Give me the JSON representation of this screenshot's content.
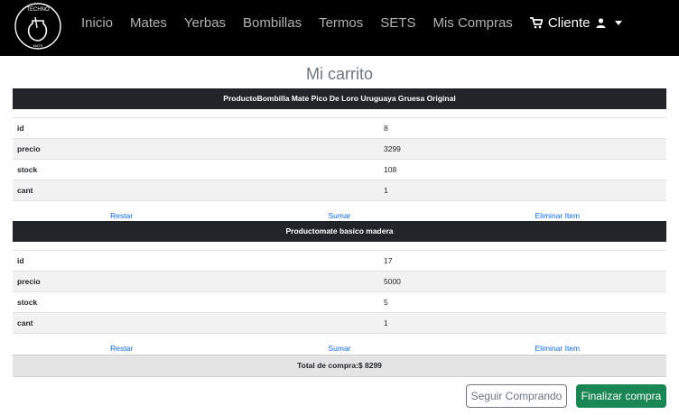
{
  "nav": {
    "logo_top": "TECHNO",
    "logo_bottom": "MATE",
    "links": [
      "Inicio",
      "Mates",
      "Yerbas",
      "Bombillas",
      "Termos",
      "SETS",
      "Mis Compras"
    ],
    "cart_label": "Cliente",
    "icons": [
      "cart-icon",
      "user-icon",
      "caret-down-icon"
    ]
  },
  "page_title": "Mi carrito",
  "products": [
    {
      "header": "ProductoBombilla Mate Pico De Loro Uruguaya Gruesa Original",
      "rows": [
        {
          "key": "id",
          "value": "8"
        },
        {
          "key": "precio",
          "value": "3299"
        },
        {
          "key": "stock",
          "value": "108"
        },
        {
          "key": "cant",
          "value": "1"
        }
      ]
    },
    {
      "header": "Productomate basico madera",
      "rows": [
        {
          "key": "id",
          "value": "17"
        },
        {
          "key": "precio",
          "value": "5000"
        },
        {
          "key": "stock",
          "value": "5"
        },
        {
          "key": "cant",
          "value": "1"
        }
      ]
    }
  ],
  "actions": {
    "restar": "Restar",
    "sumar": "Sumar",
    "eliminar": "Eliminar Item"
  },
  "total_label": "Total de compra:$ 8299",
  "buttons": {
    "seguir": "Seguir Comprando",
    "finalizar": "Finalizar compra"
  },
  "colors": {
    "navbar": "#000000",
    "link": "#0d6efd",
    "success": "#198754",
    "header_row": "#212529"
  }
}
